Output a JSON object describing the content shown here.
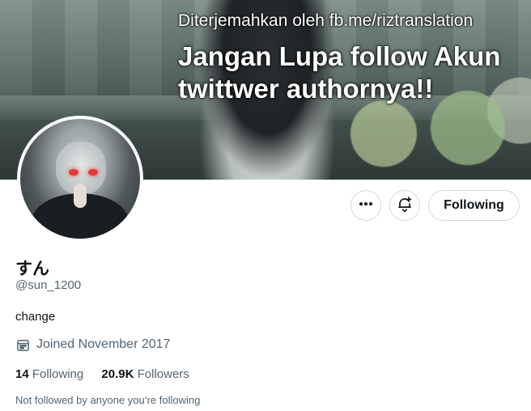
{
  "banner": {
    "credit_text": "Diterjemahkan oleh fb.me/riztranslation",
    "headline_text": "Jangan Lupa follow Akun twittwer authornya!!"
  },
  "actions": {
    "more_icon": "more-horizontal-icon",
    "notify_icon": "bell-plus-icon",
    "follow_label": "Following"
  },
  "profile": {
    "display_name": "すん",
    "handle": "@sun_1200",
    "bio": "change",
    "joined_icon": "calendar-icon",
    "joined": "Joined November 2017",
    "following_count": "14",
    "following_label": "Following",
    "followers_count": "20.9K",
    "followers_label": "Followers",
    "mutuals_note": "Not followed by anyone you’re following"
  }
}
